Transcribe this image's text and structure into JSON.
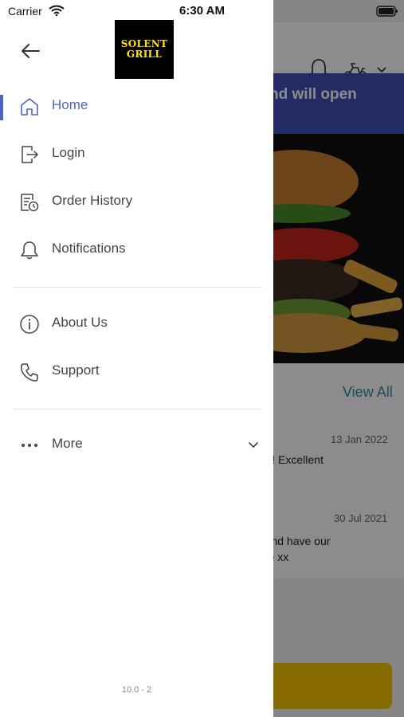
{
  "status_bar": {
    "carrier": "Carrier",
    "time": "6:30 AM"
  },
  "drawer": {
    "logo": {
      "line1": "SOLENT",
      "line2": "GRILL"
    },
    "menu": [
      {
        "label": "Home",
        "icon": "home-icon",
        "active": true
      },
      {
        "label": "Login",
        "icon": "login-icon",
        "active": false
      },
      {
        "label": "Order History",
        "icon": "order-history-icon",
        "active": false
      },
      {
        "label": "Notifications",
        "icon": "bell-icon",
        "active": false
      }
    ],
    "secondary_menu": [
      {
        "label": "About Us",
        "icon": "info-icon"
      },
      {
        "label": "Support",
        "icon": "phone-icon"
      }
    ],
    "more": {
      "label": "More",
      "icon": "more-dots-icon"
    },
    "version": "10.0 - 2",
    "accent_color": "#5263c2"
  },
  "background": {
    "banner_text": "ed and will open",
    "view_all": "View All",
    "reviews": [
      {
        "date": "13 Jan 2022",
        "text": "nk you! Excellent"
      },
      {
        "date": "30 Jul 2021",
        "text": "ussy and have our\nservice xx"
      }
    ]
  }
}
